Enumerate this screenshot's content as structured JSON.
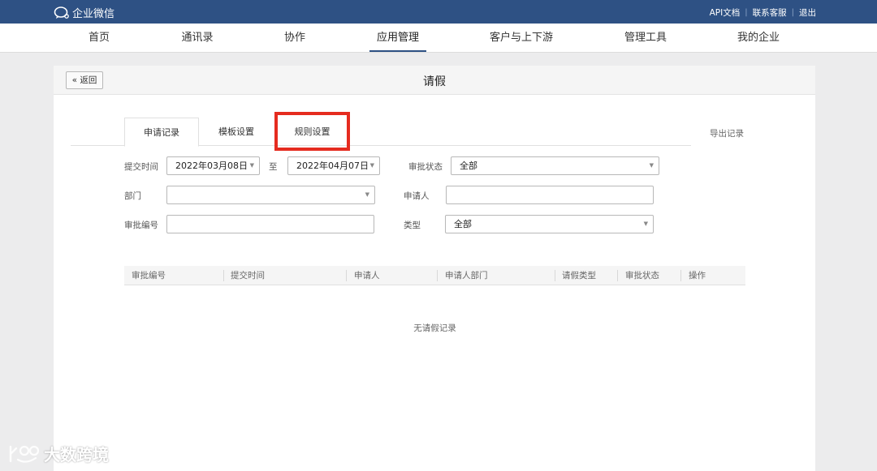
{
  "colors": {
    "topbar": "#2e5184",
    "highlight": "#e52b1f"
  },
  "topbar": {
    "logo_text": "企业微信",
    "links": [
      "API文档",
      "联系客服",
      "退出"
    ]
  },
  "nav": {
    "items": [
      "首页",
      "通讯录",
      "协作",
      "应用管理",
      "客户与上下游",
      "管理工具",
      "我的企业"
    ],
    "active": "应用管理"
  },
  "panel": {
    "back_label": "« 返回",
    "title": "请假"
  },
  "tabs": {
    "items": [
      "申请记录",
      "模板设置",
      "规则设置"
    ],
    "active": "申请记录",
    "export_label": "导出记录"
  },
  "filters": {
    "submit_time_label": "提交时间",
    "start_date": "2022年03月08日",
    "to_label": "至",
    "end_date": "2022年04月07日",
    "status_label": "审批状态",
    "status_value": "全部",
    "dept_label": "部门",
    "dept_value": "",
    "applicant_label": "申请人",
    "applicant_value": "",
    "number_label": "审批编号",
    "number_value": "",
    "type_label": "类型",
    "type_value": "全部"
  },
  "table": {
    "columns": [
      "审批编号",
      "提交时间",
      "申请人",
      "申请人部门",
      "请假类型",
      "审批状态",
      "操作"
    ],
    "empty_text": "无请假记录"
  },
  "watermark": {
    "text": "大数跨境"
  }
}
